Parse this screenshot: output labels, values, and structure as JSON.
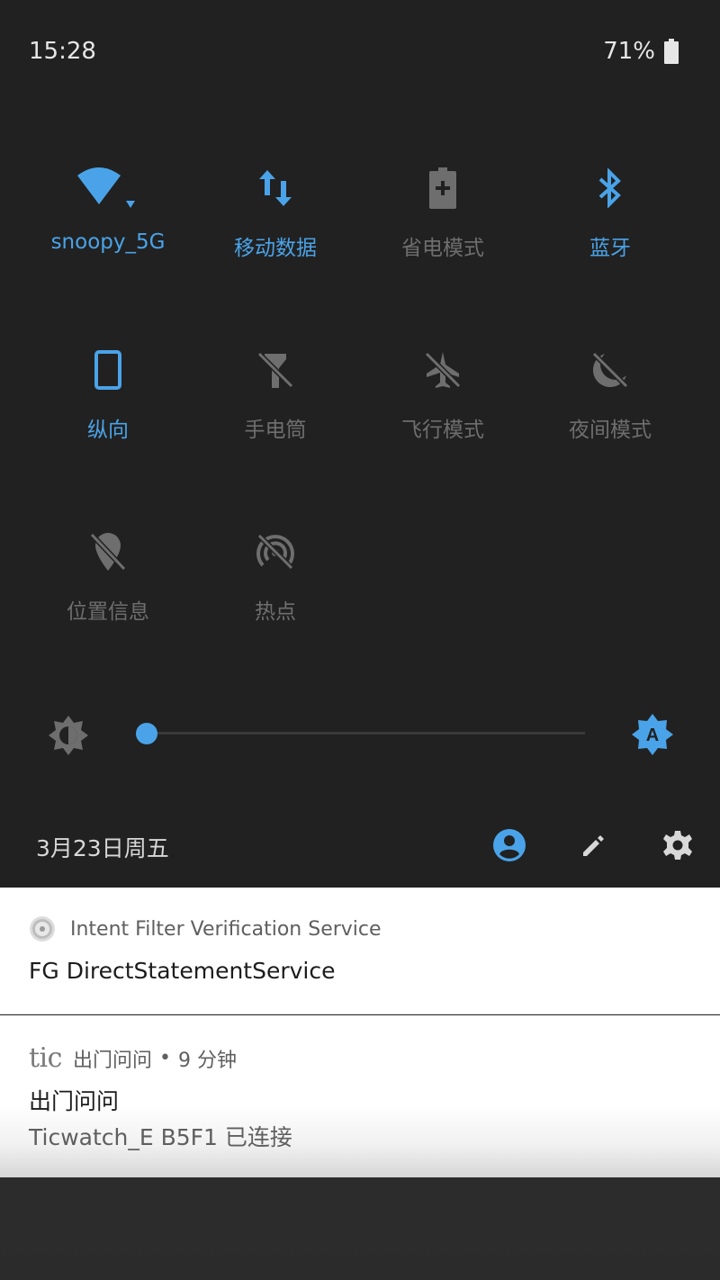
{
  "status_bar": {
    "time": "15:28",
    "battery": "71%"
  },
  "quick_settings": {
    "tiles": [
      {
        "label": "snoopy_5G",
        "icon": "wifi-icon",
        "state": "on"
      },
      {
        "label": "移动数据",
        "icon": "mobile-data-icon",
        "state": "on"
      },
      {
        "label": "省电模式",
        "icon": "battery-saver-icon",
        "state": "off"
      },
      {
        "label": "蓝牙",
        "icon": "bluetooth-icon",
        "state": "on"
      },
      {
        "label": "纵向",
        "icon": "portrait-icon",
        "state": "on"
      },
      {
        "label": "手电筒",
        "icon": "flashlight-off-icon",
        "state": "off"
      },
      {
        "label": "飞行模式",
        "icon": "airplane-off-icon",
        "state": "off"
      },
      {
        "label": "夜间模式",
        "icon": "night-mode-off-icon",
        "state": "off"
      },
      {
        "label": "位置信息",
        "icon": "location-off-icon",
        "state": "off"
      },
      {
        "label": "热点",
        "icon": "hotspot-off-icon",
        "state": "off"
      }
    ],
    "brightness": {
      "level": 0.0,
      "auto_icon": "auto-brightness-icon",
      "low_icon": "brightness-low-icon",
      "auto_label": "A"
    }
  },
  "footer": {
    "date": "3月23日周五",
    "icons": [
      "account-icon",
      "edit-icon",
      "settings-icon"
    ]
  },
  "notifications": [
    {
      "app": "Intent Filter Verification Service",
      "title": "FG DirectStatementService",
      "icon": "android-settings-icon"
    },
    {
      "logo": "tic",
      "app": "出门问问",
      "separator": "•",
      "time": "9 分钟",
      "title": "出门问问",
      "text": "Ticwatch_E B5F1 已连接"
    }
  ],
  "colors": {
    "accent": "#4aa3e8",
    "shade_bg": "#212121",
    "inactive": "#6e6e6e"
  }
}
